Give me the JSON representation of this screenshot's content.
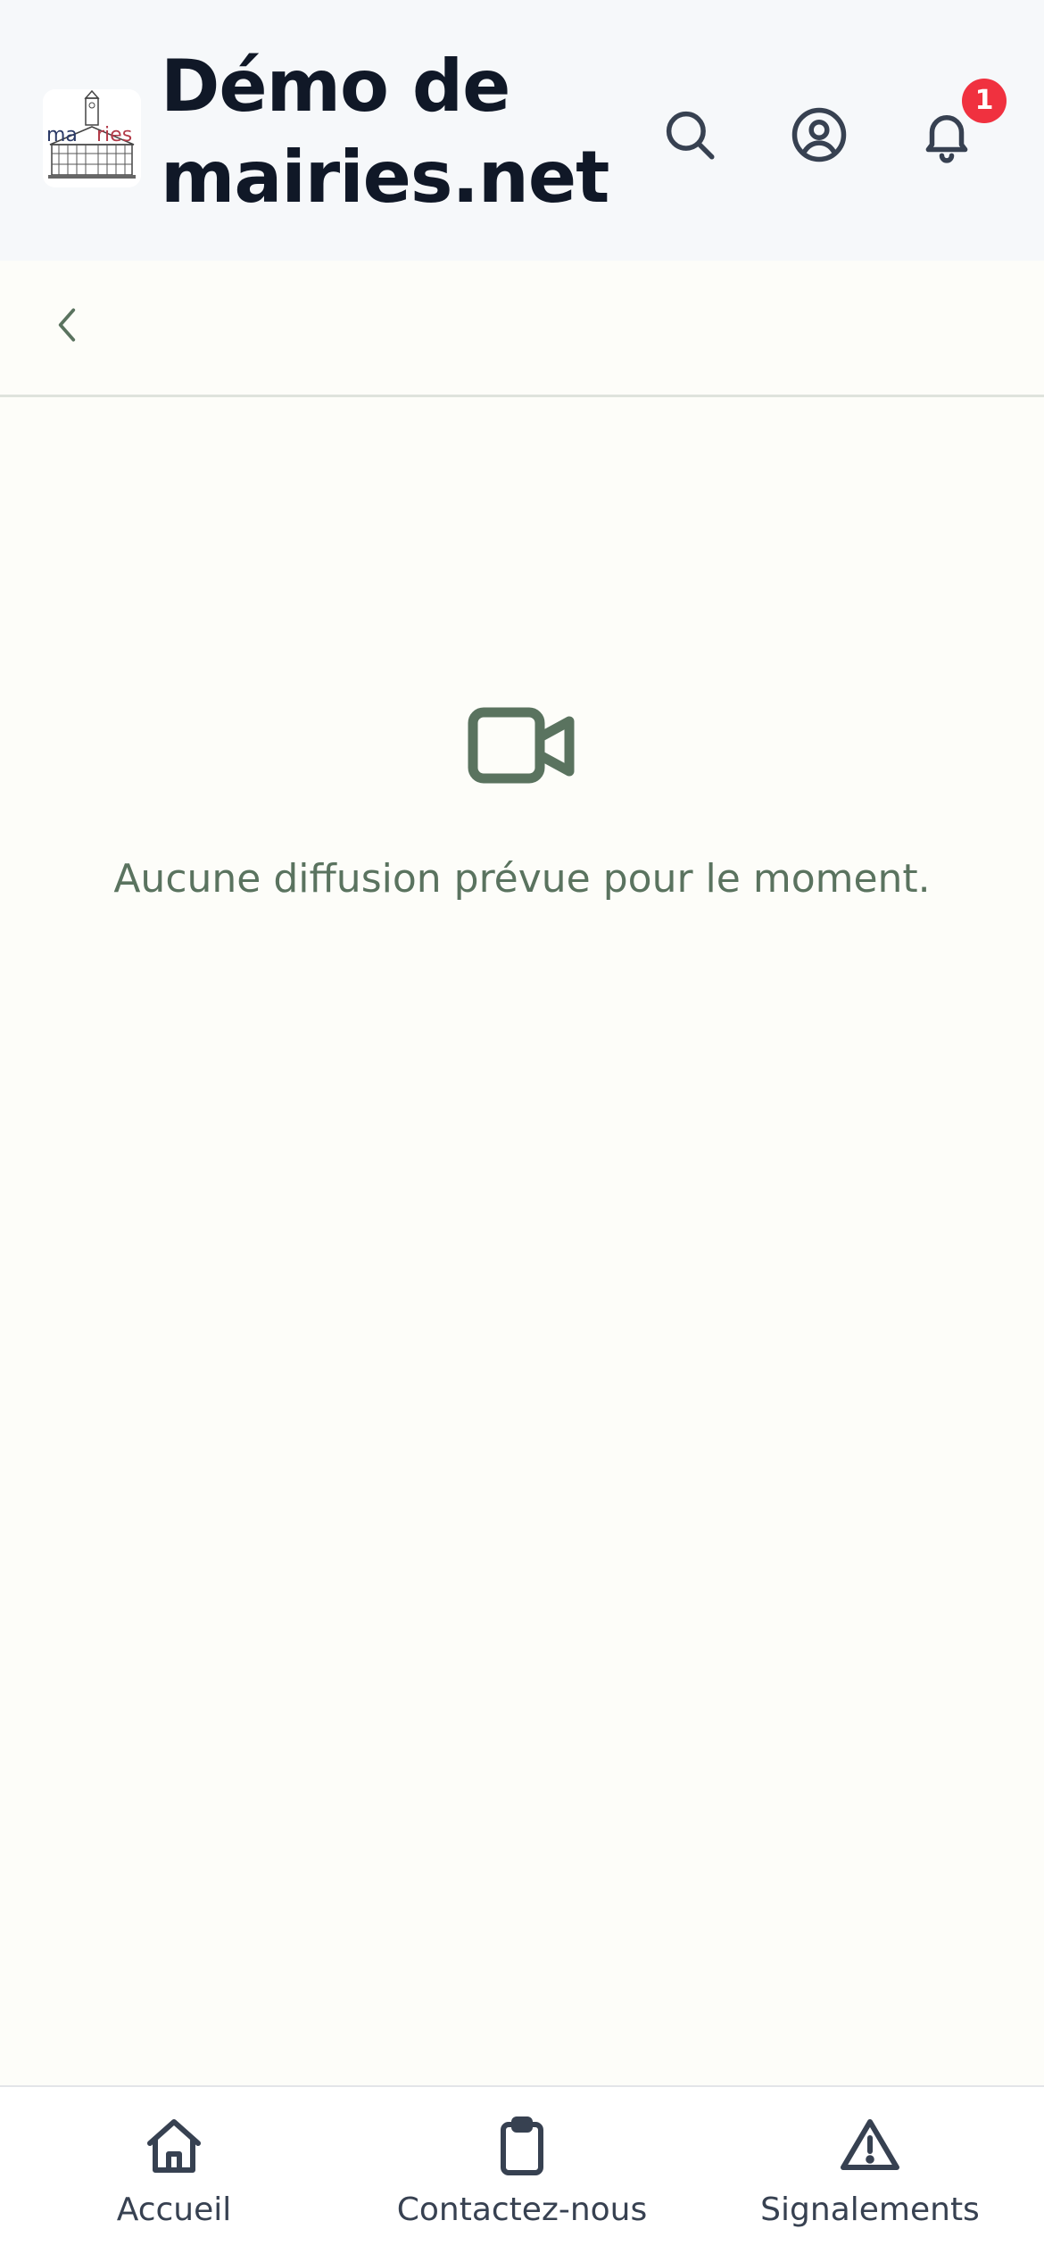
{
  "header": {
    "logo": {
      "text_left": "ma",
      "text_right": "ries",
      "icon": "town-hall-logo"
    },
    "title": "Démo de mairies.net",
    "actions": [
      {
        "name": "search",
        "icon": "search-icon"
      },
      {
        "name": "profile",
        "icon": "user-circle-icon"
      },
      {
        "name": "notifications",
        "icon": "bell-icon",
        "badge": "1"
      }
    ]
  },
  "subbar": {
    "back_icon": "chevron-left-icon"
  },
  "empty_state": {
    "icon": "video-camera-icon",
    "message": "Aucune diffusion prévue pour le moment."
  },
  "tabbar": {
    "tabs": [
      {
        "label": "Accueil",
        "icon": "home-icon"
      },
      {
        "label": "Contactez-nous",
        "icon": "clipboard-icon"
      },
      {
        "label": "Signalements",
        "icon": "warning-triangle-icon"
      }
    ]
  },
  "colors": {
    "header_bg": "#f6f8fa",
    "page_bg": "#fdfdf9",
    "accent_green": "#5a735f",
    "badge_red": "#f0313f",
    "title_text": "#101827",
    "icon_gray": "#374151"
  }
}
